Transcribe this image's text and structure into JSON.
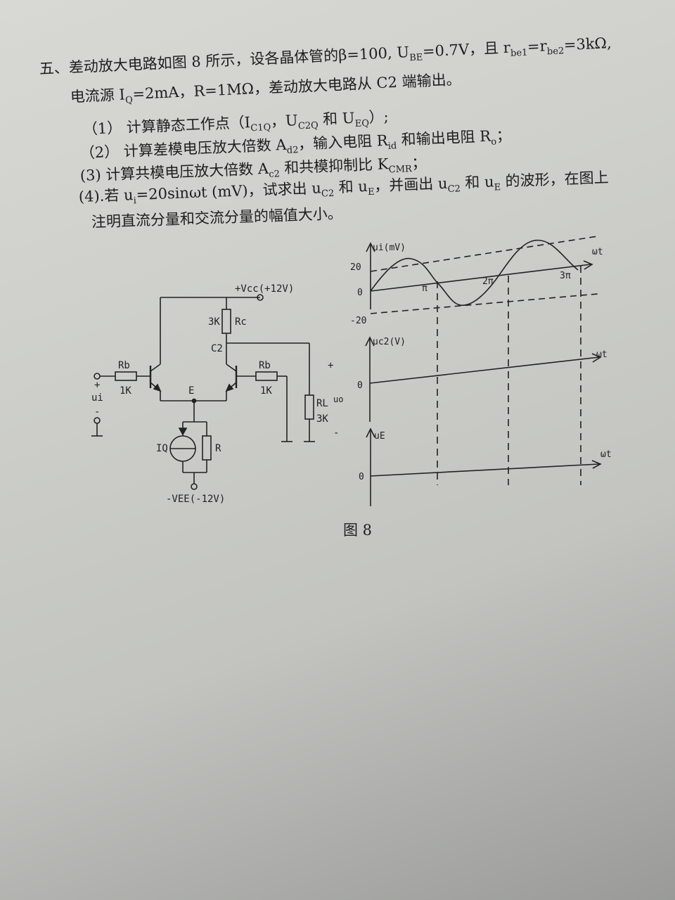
{
  "problem": {
    "line1": "五、差动放大电路如图 8 所示，设各晶体管的β=100, U",
    "line1_sub1": "BE",
    "line1_b": "=0.7V，且 r",
    "line1_sub2": "be1",
    "line1_c": "=r",
    "line1_sub3": "be2",
    "line1_d": "=3kΩ,",
    "line2": "电流源 I",
    "line2_sub": "Q",
    "line2_b": "=2mA，R=1MΩ，差动放大电路从 C2 端输出。",
    "item1": "（1） 计算静态工作点（I",
    "item1_s1": "C1Q",
    "item1_b": "，U",
    "item1_s2": "C2Q",
    "item1_c": " 和 U",
    "item1_s3": "EQ",
    "item1_d": "）;",
    "item2": "（2） 计算差模电压放大倍数 A",
    "item2_s1": "d2",
    "item2_b": "，输入电阻 R",
    "item2_s2": "id",
    "item2_c": " 和输出电阻 R",
    "item2_s3": "o",
    "item2_d": "；",
    "item3": "(3)  计算共模电压放大倍数 A",
    "item3_s1": "c2",
    "item3_b": " 和共模抑制比 K",
    "item3_s2": "CMR",
    "item3_c": "；",
    "item4": "(4).若 u",
    "item4_s1": "i",
    "item4_b": "=20sinωt (mV)，试求出 u",
    "item4_s2": "C2",
    "item4_c": " 和 u",
    "item4_s3": "E",
    "item4_d": "，并画出 u",
    "item4_s4": "C2",
    "item4_e": " 和 u",
    "item4_s5": "E",
    "item4_f": " 的波形，在图上",
    "item5": "注明直流分量和交流分量的幅值大小。"
  },
  "circuit": {
    "vcc": "+Vcc(+12V)",
    "rc_value": "3K",
    "rc_label": "Rc",
    "c2": "C2",
    "rb_left": "Rb",
    "rb_left_value": "1K",
    "rb_right": "Rb",
    "rb_right_value": "1K",
    "node_e": "E",
    "iq": "IQ",
    "r": "R",
    "vee": "-VEE(-12V)",
    "rl": "RL",
    "uo": "uo",
    "rl_value": "3K",
    "ui": "ui",
    "plus": "+",
    "minus": "-",
    "in_plus": "+",
    "in_minus": "-"
  },
  "waveforms": {
    "top_ylabel": "ui(mV)",
    "top_xlabel": "ωt",
    "tick_20": "20",
    "tick_0": "0",
    "tick_m20": "-20",
    "pi": "π",
    "two_pi": "2π",
    "three_pi": "3π",
    "mid_ylabel": "uc2(V)",
    "mid_xlabel": "ωt",
    "mid_zero": "0",
    "bot_ylabel": "uE",
    "bot_xlabel": "ωt",
    "bot_zero": "0"
  },
  "caption": "图 8"
}
